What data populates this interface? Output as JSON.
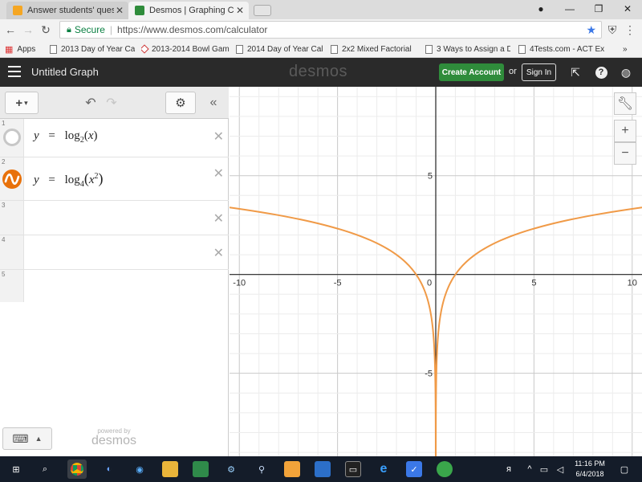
{
  "browser": {
    "tabs": [
      {
        "title": "Answer students' questio",
        "favicon": "chegg-favicon",
        "active": false
      },
      {
        "title": "Desmos | Graphing Calcu",
        "favicon": "desmos-favicon",
        "active": true
      }
    ],
    "address": {
      "secure_label": "Secure",
      "url": "https://www.desmos.com/calculator"
    },
    "bookmarks": [
      {
        "label": "Apps"
      },
      {
        "label": "2013 Day of Year Ca"
      },
      {
        "label": "2013-2014 Bowl Gam"
      },
      {
        "label": "2014 Day of Year Cal"
      },
      {
        "label": "2x2 Mixed Factorial"
      },
      {
        "label": "3 Ways to Assign a D"
      },
      {
        "label": "4Tests.com - ACT Ex"
      }
    ],
    "overflow_label": "»"
  },
  "header": {
    "graph_title": "Untitled Graph",
    "logo": "desmos",
    "create_account": "Create Account",
    "or": "or",
    "sign_in": "Sign In"
  },
  "expressions": [
    {
      "index": "1",
      "lhs": "y",
      "eq": "=",
      "fn": "log",
      "base": "2",
      "arg": "x",
      "exponent": "",
      "color": "#c7c7c7",
      "hidden": true
    },
    {
      "index": "2",
      "lhs": "y",
      "eq": "=",
      "fn": "log",
      "base": "4",
      "arg": "x",
      "exponent": "2",
      "color": "#e8710a",
      "hidden": false
    },
    {
      "index": "3"
    },
    {
      "index": "4"
    },
    {
      "index": "5"
    }
  ],
  "panel": {
    "powered_by": "powered by",
    "powered_logo": "desmos"
  },
  "chart_data": {
    "type": "line",
    "title": "",
    "xlabel": "",
    "ylabel": "",
    "xlim": [
      -10.5,
      10.5
    ],
    "ylim": [
      -9.2,
      9.5
    ],
    "x_ticks": [
      "-10",
      "-5",
      "0",
      "5",
      "10"
    ],
    "y_ticks": [
      "5",
      "-5"
    ],
    "grid": true,
    "minor_grid_step": 1,
    "major_grid_step": 5,
    "series": [
      {
        "expression": "y = log_4(x^2)",
        "color": "#f09a47",
        "x": [
          -10.5,
          -10,
          -5,
          -2,
          -1,
          -0.5,
          -0.1,
          0.1,
          0.5,
          1,
          2,
          5,
          10,
          10.5
        ],
        "y": [
          3.39,
          3.32,
          2.32,
          1.0,
          0.0,
          -1.0,
          -3.32,
          -3.32,
          -1.0,
          0.0,
          1.0,
          2.32,
          3.32,
          3.39
        ]
      }
    ]
  },
  "taskbar": {
    "time": "11:16 PM",
    "date": "6/4/2018"
  }
}
